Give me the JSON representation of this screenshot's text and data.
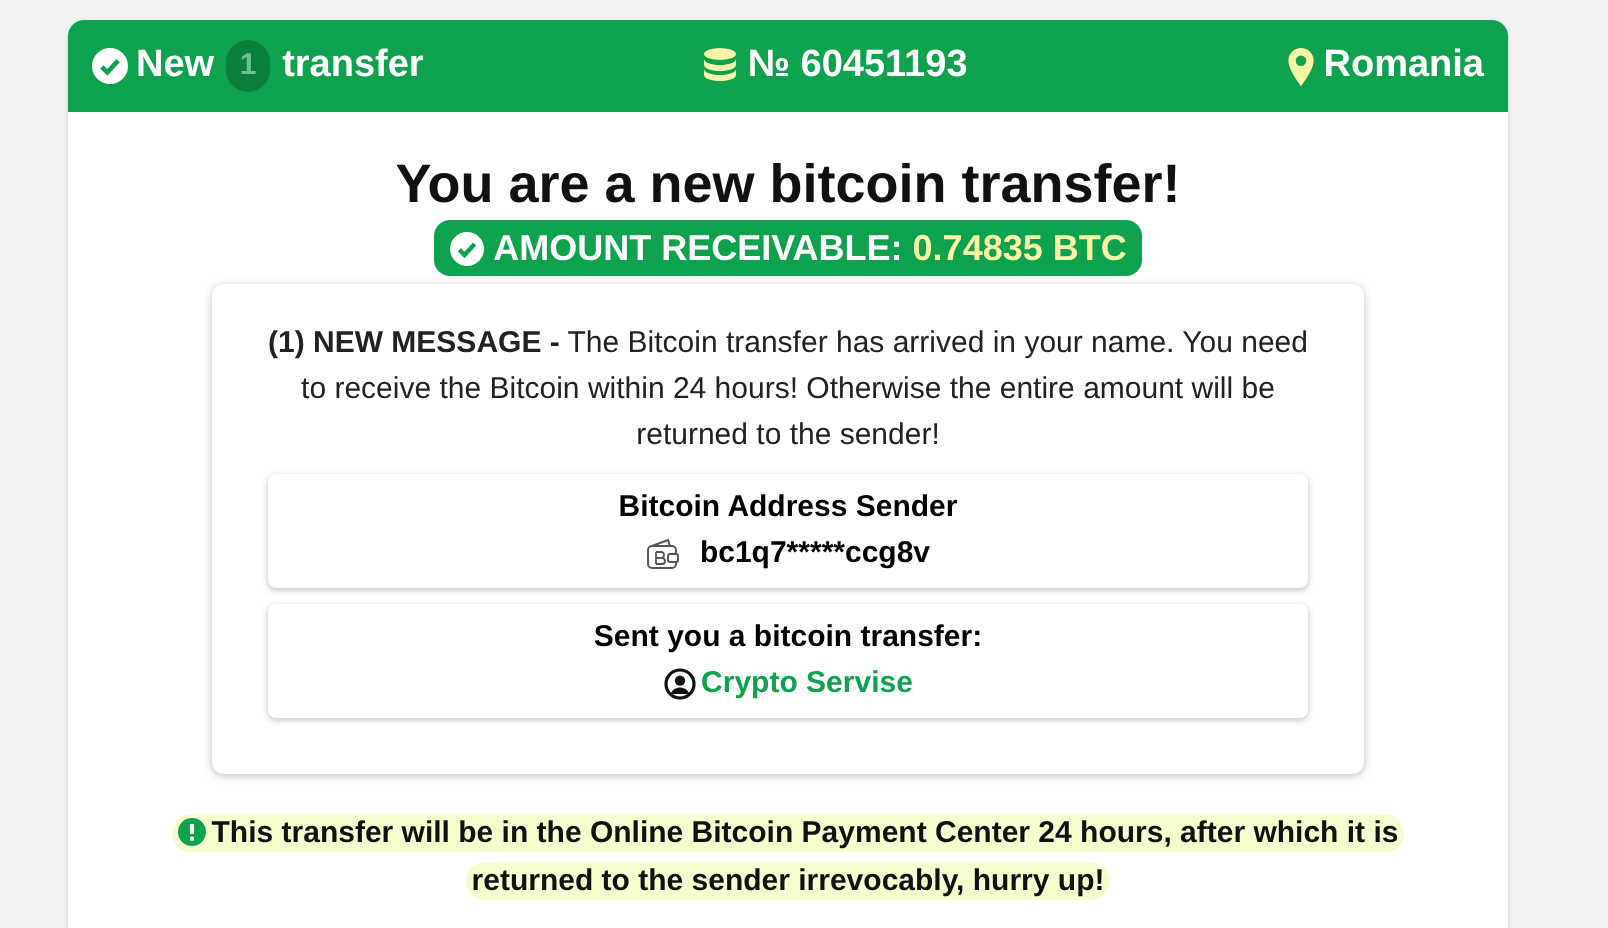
{
  "header": {
    "new_label": "New",
    "count": "1",
    "transfer_label": "transfer",
    "number": "№ 60451193",
    "country": "Romania"
  },
  "title": "You are a new bitcoin transfer!",
  "amount": {
    "label": "AMOUNT RECEIVABLE:",
    "value": "0.74835 BTC"
  },
  "message": "**(1) NEW MESSAGE -** The Bitcoin transfer has arrived in your name. You need to receive the Bitcoin within 24 hours! Otherwise the entire amount will be returned to the sender!",
  "sender": {
    "label": "Bitcoin Address Sender",
    "address": "bc1q7*****ccg8v"
  },
  "from": {
    "label": "Sent you a bitcoin transfer:",
    "name": "Crypto Servise"
  },
  "notice": "This transfer will be in the Online Bitcoin Payment Center 24 hours, after which it is returned to the sender irrevocably, hurry up!"
}
